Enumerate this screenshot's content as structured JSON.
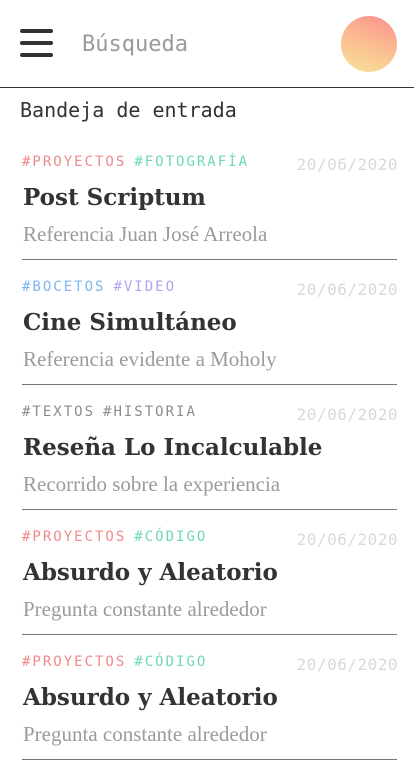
{
  "header": {
    "search_placeholder": "Búsqueda"
  },
  "inbox": {
    "title": "Bandeja de entrada"
  },
  "tag_colors": {
    "#PROYECTOS": "#f08a8a",
    "#FOTOGRAFÍA": "#6fd9b4",
    "#BOCETOS": "#7fb5f2",
    "#VIDEO": "#b3a1f2",
    "#TEXTOS": "#8c8c8c",
    "#HISTORIA": "#8c8c8c",
    "#CÓDIGO": "#6fd9b4"
  },
  "items": [
    {
      "tags": [
        "#PROYECTOS",
        "#FOTOGRAFÍA"
      ],
      "date": "20/06/2020",
      "title": "Post Scriptum",
      "subtitle": "Referencia Juan José Arreola"
    },
    {
      "tags": [
        "#BOCETOS",
        "#VIDEO"
      ],
      "date": "20/06/2020",
      "title": "Cine Simultáneo",
      "subtitle": "Referencia evidente a Moholy"
    },
    {
      "tags": [
        "#TEXTOS",
        "#HISTORIA"
      ],
      "date": "20/06/2020",
      "title": "Reseña Lo Incalculable",
      "subtitle": "Recorrido sobre la experiencia"
    },
    {
      "tags": [
        "#PROYECTOS",
        "#CÓDIGO"
      ],
      "date": "20/06/2020",
      "title": "Absurdo y Aleatorio",
      "subtitle": "Pregunta constante alrededor"
    },
    {
      "tags": [
        "#PROYECTOS",
        "#CÓDIGO"
      ],
      "date": "20/06/2020",
      "title": "Absurdo y Aleatorio",
      "subtitle": "Pregunta constante alrededor"
    }
  ]
}
